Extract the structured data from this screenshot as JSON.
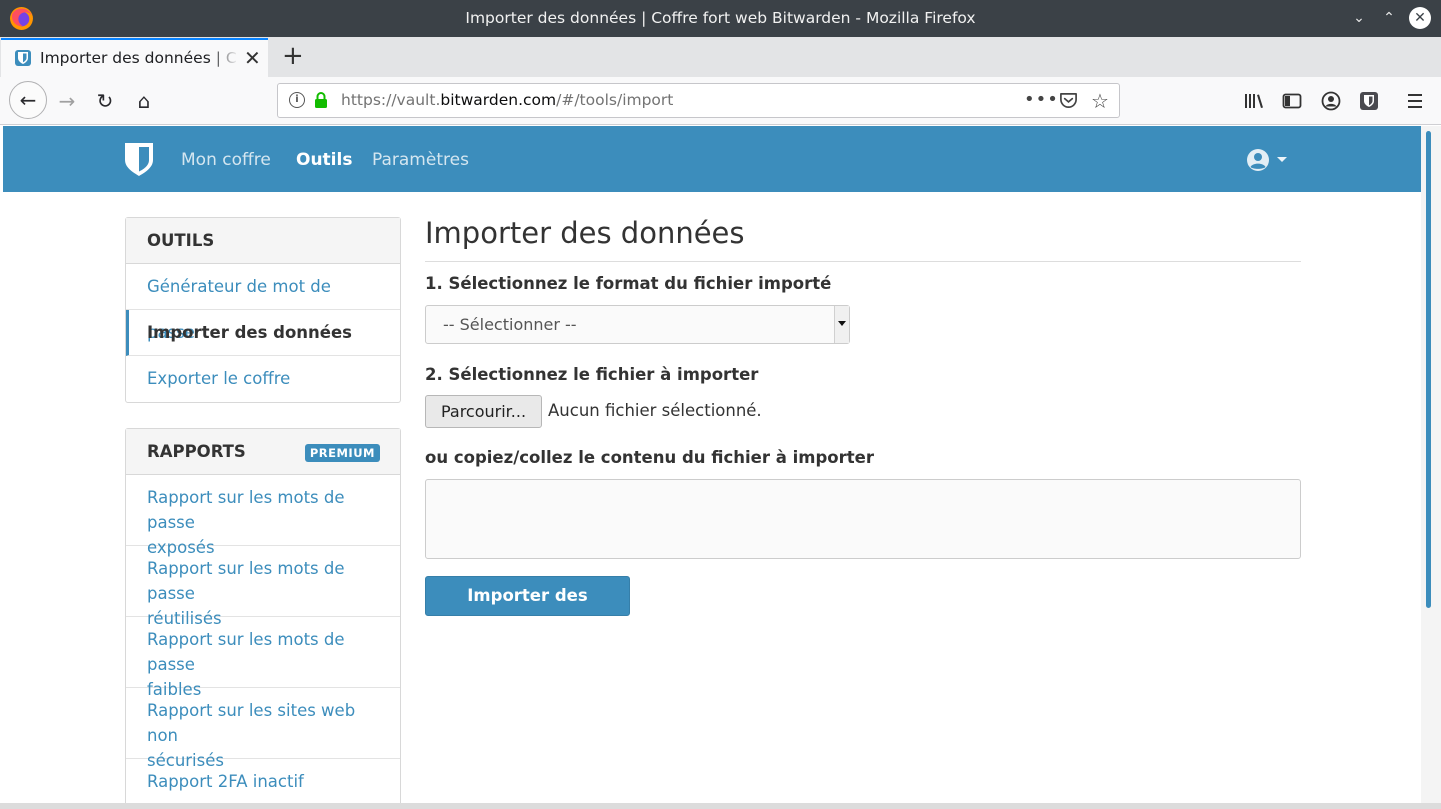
{
  "window": {
    "title": "Importer des données | Coffre fort web Bitwarden - Mozilla Firefox",
    "minimize_glyph": "⌄",
    "maximize_glyph": "⌃",
    "close_glyph": "✕"
  },
  "tabs": [
    {
      "label": "Importer des données | Coffre fort web Bitwarden",
      "close_glyph": "✕",
      "favicon": "bitwarden-shield-icon"
    }
  ],
  "new_tab_glyph": "+",
  "toolbar": {
    "back_glyph": "←",
    "forward_glyph": "→",
    "reload_glyph": "↻",
    "home_glyph": "⌂",
    "url_prefix": "https://vault.",
    "url_domain": "bitwarden.com",
    "url_path": "/#/tools/import",
    "page_actions_glyph": "•••",
    "bookmark_glyph": "☆",
    "info_glyph": "i"
  },
  "app_nav": {
    "links": [
      "Mon coffre",
      "Outils",
      "Paramètres"
    ],
    "active": "Outils"
  },
  "sidebar": {
    "tools": {
      "title": "OUTILS",
      "items": [
        "Générateur de mot de passe",
        "Importer des données",
        "Exporter le coffre"
      ],
      "active": "Importer des données"
    },
    "reports": {
      "title": "RAPPORTS",
      "badge": "PREMIUM",
      "items": [
        {
          "line1": "Rapport sur les mots de passe",
          "line2": "exposés"
        },
        {
          "line1": "Rapport sur les mots de passe",
          "line2": "réutilisés"
        },
        {
          "line1": "Rapport sur les mots de passe",
          "line2": "faibles"
        },
        {
          "line1": "Rapport sur les sites web non",
          "line2": "sécurisés"
        },
        {
          "line1": "Rapport 2FA inactif",
          "line2": ""
        }
      ]
    }
  },
  "main": {
    "title": "Importer des données",
    "step1_label": "1. Sélectionnez le format du fichier importé",
    "format_select_value": "-- Sélectionner --",
    "step2_label": "2. Sélectionnez le fichier à importer",
    "browse_button": "Parcourir...",
    "file_status": "Aucun fichier sélectionné.",
    "paste_label": "ou copiez/collez le contenu du fichier à importer",
    "paste_value": "",
    "submit_button": "Importer des données"
  },
  "colors": {
    "brand": "#3c8dbc",
    "titlebar": "#3b4147",
    "text": "#333333"
  }
}
